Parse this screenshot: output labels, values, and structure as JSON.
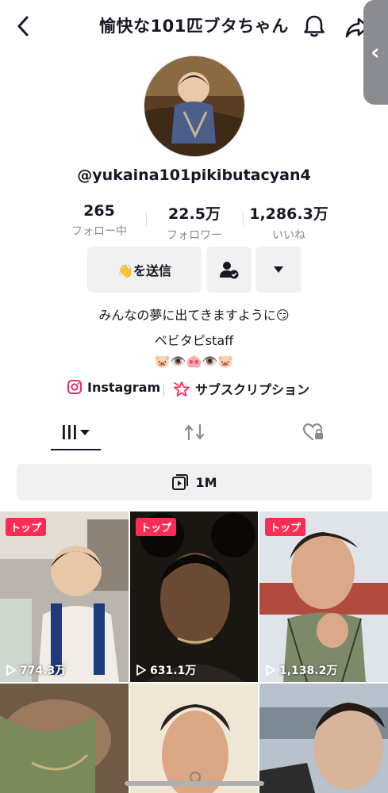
{
  "header": {
    "title": "愉快な101匹ブタちゃん",
    "back_icon": "chevron-left-icon",
    "bell_icon": "bell-icon",
    "share_icon": "share-icon"
  },
  "profile": {
    "handle": "@yukaina101pikibutacyan4",
    "stats": [
      {
        "value": "265",
        "label": "フォロー中"
      },
      {
        "value": "22.5万",
        "label": "フォロワー"
      },
      {
        "value": "1,286.3万",
        "label": "いいね"
      }
    ],
    "actions": {
      "send_label": "👋を送信",
      "add_friend_icon": "person-check-icon",
      "more_icon": "caret-down-icon"
    },
    "bio": [
      "みんなの夢に出てきますように😏",
      "ベビタピstaff",
      "🐷👁️🐽👁️🐷"
    ],
    "links": {
      "instagram": "Instagram",
      "subscription": "サブスクリプション"
    }
  },
  "tabs": {
    "videos_icon": "grid-icon",
    "reposts_icon": "repost-icon",
    "liked_icon": "heart-lock-icon"
  },
  "playlist": {
    "label": "1M",
    "icon": "playlist-icon"
  },
  "videos": [
    {
      "badge": "トップ",
      "views": "774.3万"
    },
    {
      "badge": "トップ",
      "views": "631.1万"
    },
    {
      "badge": "トップ",
      "views": "1,138.2万"
    },
    {
      "badge": "",
      "views": ""
    },
    {
      "badge": "",
      "views": ""
    },
    {
      "badge": "",
      "views": ""
    }
  ],
  "colors": {
    "accent": "#fe2c55",
    "text": "#161823",
    "muted": "#8a8b91",
    "button_bg": "#f1f1f2"
  }
}
